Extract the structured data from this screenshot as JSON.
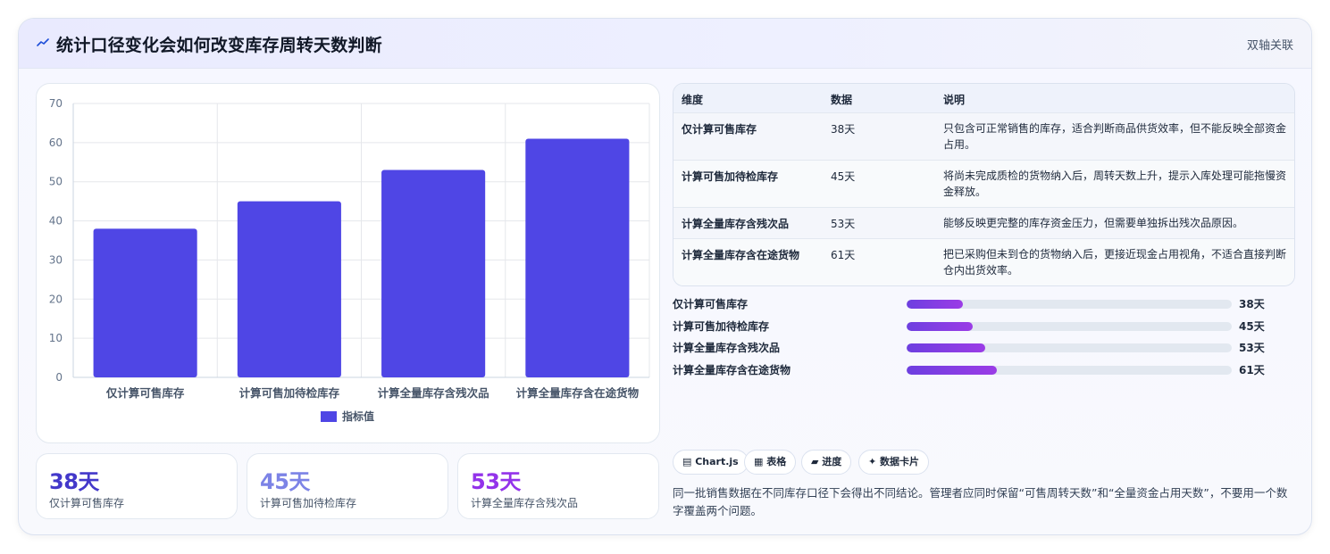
{
  "header": {
    "icon": "line-chart-icon",
    "title": "统计口径变化会如何改变库存周转天数判断",
    "tag": "双轴关联"
  },
  "chart_data": {
    "type": "bar",
    "categories": [
      "仅计算可售库存",
      "计算可售加待检库存",
      "计算全量库存含残次品",
      "计算全量库存含在途货物"
    ],
    "series": [
      {
        "name": "指标值",
        "values": [
          38,
          45,
          53,
          61
        ],
        "color": "#4f46e5"
      }
    ],
    "ylim": [
      0,
      70
    ],
    "yticks": [
      0,
      10,
      20,
      30,
      40,
      50,
      60,
      70
    ],
    "grid": true,
    "legend": "bottom"
  },
  "stats": [
    {
      "value": "38天",
      "label": "仅计算可售库存",
      "color": "#4338ca"
    },
    {
      "value": "45天",
      "label": "计算可售加待检库存",
      "color": "#7c83e6"
    },
    {
      "value": "53天",
      "label": "计算全量库存含残次品",
      "color": "#9333ea"
    }
  ],
  "table": {
    "headers": [
      "维度",
      "数据",
      "说明"
    ],
    "rows": [
      {
        "dim": "仅计算可售库存",
        "val": "38天",
        "desc": "只包含可正常销售的库存，适合判断商品供货效率，但不能反映全部资金占用。"
      },
      {
        "dim": "计算可售加待检库存",
        "val": "45天",
        "desc": "将尚未完成质检的货物纳入后，周转天数上升，提示入库处理可能拖慢资金释放。"
      },
      {
        "dim": "计算全量库存含残次品",
        "val": "53天",
        "desc": "能够反映更完整的库存资金压力，但需要单独拆出残次品原因。"
      },
      {
        "dim": "计算全量库存含在途货物",
        "val": "61天",
        "desc": "把已采购但未到仓的货物纳入后，更接近现金占用视角，不适合直接判断仓内出货效率。"
      }
    ]
  },
  "progress": {
    "max": 220,
    "items": [
      {
        "label": "仅计算可售库存",
        "value": 38,
        "text": "38天"
      },
      {
        "label": "计算可售加待检库存",
        "value": 45,
        "text": "45天"
      },
      {
        "label": "计算全量库存含残次品",
        "value": 53,
        "text": "53天"
      },
      {
        "label": "计算全量库存含在途货物",
        "value": 61,
        "text": "61天"
      }
    ]
  },
  "chips": [
    "▤ Chart.js",
    "▦ 表格",
    "▰ 进度",
    "✦ 数据卡片"
  ],
  "note": "同一批销售数据在不同库存口径下会得出不同结论。管理者应同时保留“可售周转天数”和“全量资金占用天数”，不要用一个数字覆盖两个问题。"
}
